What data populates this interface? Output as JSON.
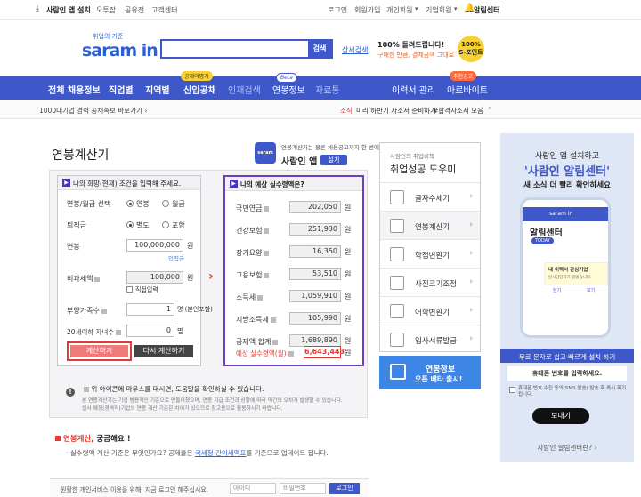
{
  "topbar": {
    "install": "사람인 앱 설치",
    "blog": "오투잡",
    "notice": "공유전",
    "support": "고객센터",
    "login": "로그인",
    "join": "회원가입",
    "personal": "개인회원",
    "corporate": "기업회원",
    "alarm": "알림센터"
  },
  "header": {
    "logo_tag": "취업의 기준",
    "logo": "saram in",
    "search_btn": "검색",
    "detail_search": "상세검색",
    "promo1": "100% 돌려드립니다!",
    "promo2": "구매한 만큼, 결제금액 그대로",
    "promo_badge": "100% S-포인트"
  },
  "nav": {
    "items": [
      "전체 채용정보",
      "직업별",
      "지역별",
      "신입공채",
      "인재검색",
      "연봉정보",
      "자료통"
    ],
    "badge_public": "공채의명가",
    "badge_beta": "Beta",
    "resume": "이력서 관리",
    "part_time": "아르바이트",
    "badge_recommend": "추천공고"
  },
  "ticker": {
    "left": "1000대기업 경력 공채속보 바로가기 ›",
    "right_label": "소식",
    "right_text": "미리 하반기 자소서 준비하기",
    "right_suffix": "#합격자소서 모음"
  },
  "calc": {
    "title": "연봉계산기",
    "app_promo1": "연봉계산기는 물론 채용공고까지 한 번에!",
    "app_name": "사람인 앱",
    "app_install": "설치",
    "left_header": "나의 희망(현재) 조건을 입력해 주세요.",
    "labels": {
      "salary_type": "연봉/월급 선택",
      "annual": "연봉",
      "monthly": "월급",
      "severance": "퇴직금",
      "separate": "별도",
      "included": "포함",
      "salary": "연봉",
      "unit_won": "원",
      "input_hint": "입력금",
      "nontax": "비과세액",
      "direct_input": "직접입력",
      "dependents": "부양가족수",
      "dependents_unit": "명 (본인포함)",
      "children": "20세이하 자녀수",
      "children_unit": "명"
    },
    "values": {
      "salary": "100,000,000",
      "nontax": "100,000",
      "dependents": "1",
      "children": "0"
    },
    "calc_btn": "계산하기",
    "reset_btn": "다시 계산하기",
    "right_header": "나의 예상 실수령액은?",
    "results": [
      {
        "label": "국민연금",
        "value": "202,050"
      },
      {
        "label": "건강보험",
        "value": "251,930"
      },
      {
        "label": "장기요양",
        "value": "16,350"
      },
      {
        "label": "고용보험",
        "value": "53,510"
      },
      {
        "label": "소득세",
        "value": "1,059,910"
      },
      {
        "label": "지방소득세",
        "value": "105,990"
      },
      {
        "label": "공제액 합계",
        "value": "1,689,890"
      }
    ],
    "result_net_label": "예상 실수령액(월)",
    "result_net_value": "6,643,443",
    "note_title": "위 아이콘에 마우스를 대시면, 도움말을 확인하실 수 있습니다.",
    "note_body1": "본 연봉계산기는 기업 범용적인 기준으로 만들어졌으며, 연봉 지급 조건과 상황에 따라 약간의 오차가 발생할 수 있습니다.",
    "note_body2": "입사 예정(경력직)기업의 연봉 계산 기준은 차이가 있으므로 참고용으로 활용하시기 바랍니다.",
    "faq_title_red": "연봉계산,",
    "faq_title": " 궁금해요 !",
    "faq_line1": "· 실수령액 계산 기준은 무엇인가요? 공제율은 ",
    "faq_link": "국세청 간이세액표",
    "faq_line2": "를 기준으로 업데이트 됩니다."
  },
  "sidebar": {
    "subtitle": "사람인의 취업비책",
    "title": "취업성공 도우미",
    "items": [
      "글자수세기",
      "연봉계산기",
      "학점변환기",
      "사진크기조정",
      "어학변환기",
      "입사서류발급"
    ],
    "banner_t1": "연봉정보",
    "banner_t2": "오픈 베타 출시!"
  },
  "ad": {
    "line1": "사람인 앱 설치하고",
    "line2": "'사람인 알림센터'",
    "line3": "새 소식 더 빨리 확인하세요",
    "phone_title": "알림센터",
    "phone_today": "TODAY",
    "phone_card1": "내 이력서 관심기업",
    "phone_card2": "인사담당자가 읽었습니다.",
    "phone_btn1": "닫기",
    "phone_btn2": "보기",
    "free_msg": "무료 문자로 쉽고 빠르게 설치 하기",
    "phone_input": "휴대폰 번호를 입력하세요.",
    "agree": "휴대폰 번호 수집 동의(SMS 발송) 발송 후 즉시 파기 됩니다.",
    "send": "보내기",
    "what": "사람인 알림센터란? ›"
  },
  "login": {
    "msg": "원활한 개인서비스 이용을 위해, 지금 로그인 해주십시요.",
    "id": "아이디",
    "pw": "비밀번호",
    "btn": "로그인"
  },
  "colors": {
    "nav": "#3e58c9",
    "accent": "#4a34b8",
    "red": "#e53935",
    "result_border": "#6a3fbf"
  }
}
